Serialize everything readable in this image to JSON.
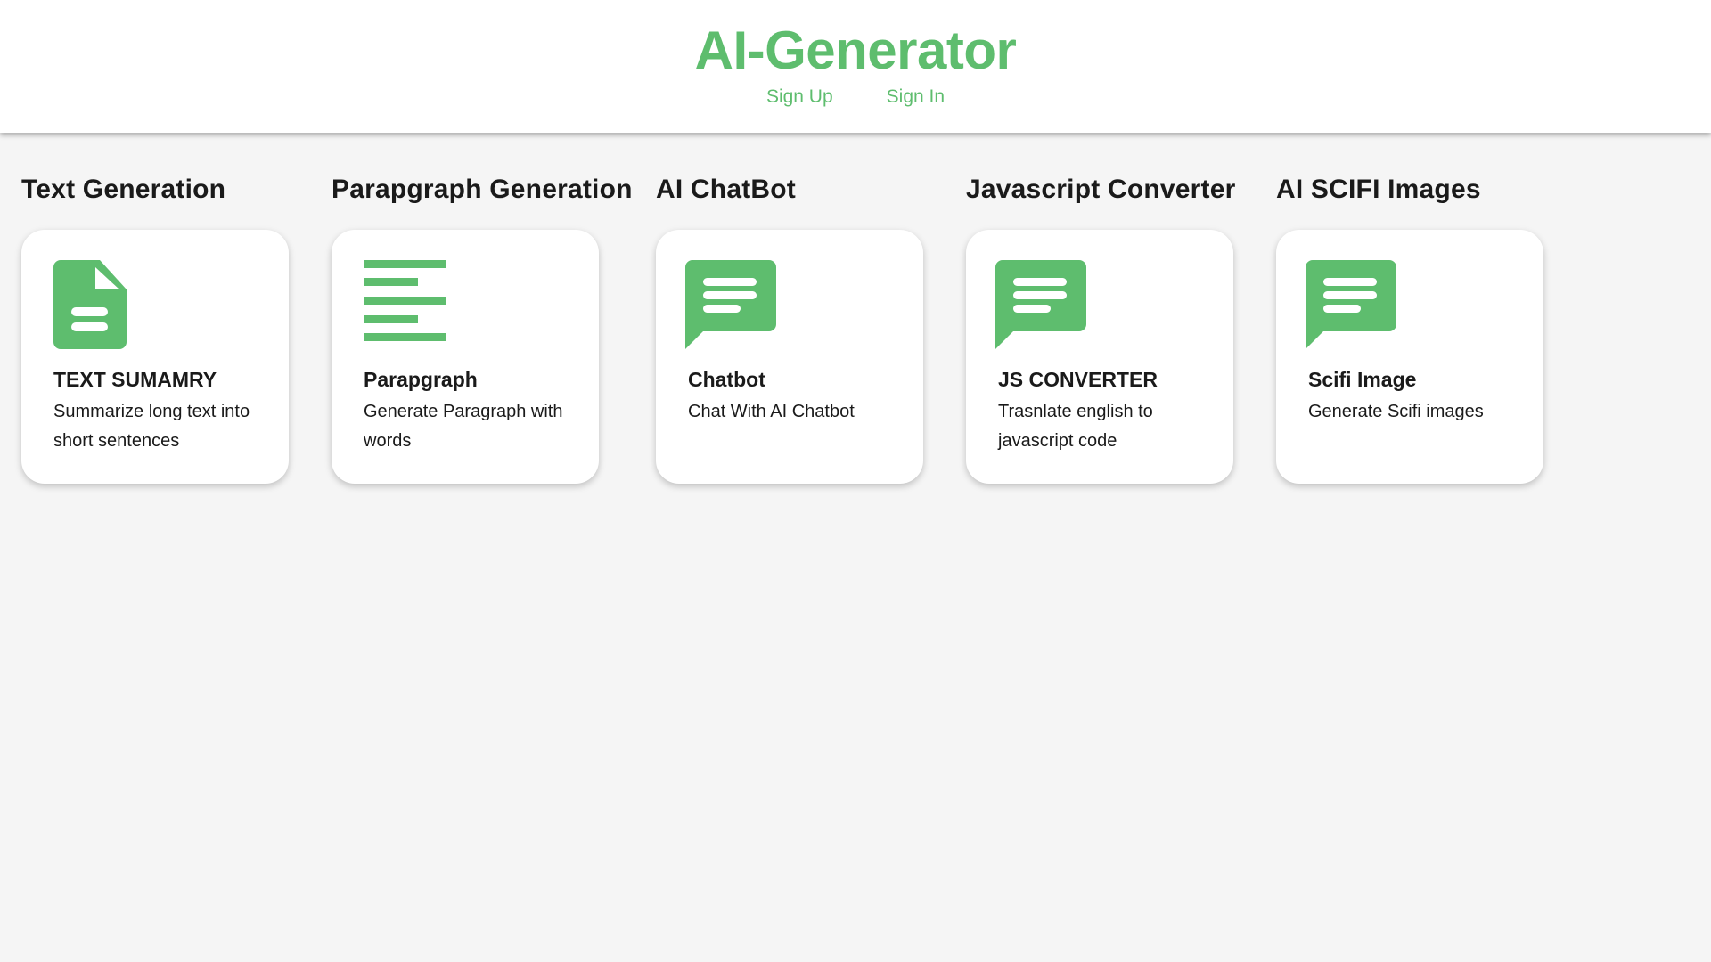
{
  "header": {
    "title": "AI-Generator",
    "nav": {
      "sign_up": "Sign Up",
      "sign_in": "Sign In"
    }
  },
  "colors": {
    "accent": "#5ebd6e",
    "background": "#f5f5f5",
    "card": "#ffffff"
  },
  "sections": [
    {
      "heading": "Text Generation",
      "icon": "document-icon",
      "card_title": "TEXT SUMAMRY",
      "card_desc": "Summarize long text into short sentences"
    },
    {
      "heading": "Parapgraph Generation",
      "icon": "paragraph-lines-icon",
      "card_title": "Parapgraph",
      "card_desc": "Generate Paragraph with words"
    },
    {
      "heading": "AI ChatBot",
      "icon": "chat-bubble-icon",
      "card_title": "Chatbot",
      "card_desc": "Chat With AI Chatbot"
    },
    {
      "heading": "Javascript Converter",
      "icon": "chat-bubble-icon",
      "card_title": "JS CONVERTER",
      "card_desc": "Trasnlate english to javascript code"
    },
    {
      "heading": "AI SCIFI Images",
      "icon": "chat-bubble-icon",
      "card_title": "Scifi Image",
      "card_desc": "Generate Scifi images"
    }
  ]
}
